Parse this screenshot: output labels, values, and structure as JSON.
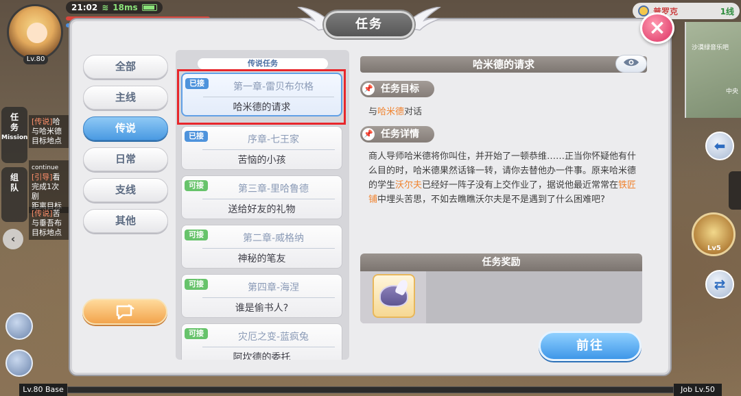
{
  "hud": {
    "time": "21:02",
    "ping": "18ms",
    "player_level": "Lv.80",
    "server_city": "普罗克",
    "server_line": "1线",
    "map_label": "沙漠绿音乐吧",
    "map_label_2": "中央",
    "mission_tab": [
      "任",
      "务",
      "Mission"
    ],
    "team_tab": [
      "组",
      "队"
    ],
    "quest_peek": [
      {
        "tag": "[传说]",
        "line1": "哈",
        "line2": "与哈米德",
        "line3": "目标地点"
      },
      {
        "tag": "[引导]",
        "line1": "看",
        "line2": "完成1次剧",
        "line3": "距离目标"
      },
      {
        "tag": "[传说]",
        "line1": "苦",
        "line2": "与垂吾布",
        "line3": "目标地点"
      }
    ],
    "continue_label": "continue",
    "skill_level": "Lv5",
    "base_level": "Lv.80 Base",
    "job_level": "Job Lv.50"
  },
  "dialog": {
    "title": "任务",
    "close_label": "×",
    "categories": [
      {
        "label": "全部",
        "active": false
      },
      {
        "label": "主线",
        "active": false
      },
      {
        "label": "传说",
        "active": true
      },
      {
        "label": "日常",
        "active": false
      },
      {
        "label": "支线",
        "active": false
      },
      {
        "label": "其他",
        "active": false
      }
    ],
    "special_button_icon": "chat-bubble-icon",
    "list_header": "传说任务",
    "quests": [
      {
        "badge": "已接",
        "badge_type": "taken",
        "chapter": "第一章-雷贝布尔格",
        "name": "哈米德的请求",
        "selected": true
      },
      {
        "badge": "已接",
        "badge_type": "taken",
        "chapter": "序章-七王家",
        "name": "苦恼的小孩",
        "selected": false
      },
      {
        "badge": "可接",
        "badge_type": "avail",
        "chapter": "第三章-里哈鲁德",
        "name": "送给好友的礼物",
        "selected": false
      },
      {
        "badge": "可接",
        "badge_type": "avail",
        "chapter": "第二章-威格纳",
        "name": "神秘的笔友",
        "selected": false
      },
      {
        "badge": "可接",
        "badge_type": "avail",
        "chapter": "第四章-海涅",
        "name": "谁是偷书人?",
        "selected": false
      },
      {
        "badge": "可接",
        "badge_type": "avail",
        "chapter": "灾厄之变-蓝疯兔",
        "name": "阿坎德的委托",
        "selected": false
      }
    ],
    "detail": {
      "title": "哈米德的请求",
      "goal_header": "任务目标",
      "goal_prefix": "与",
      "goal_highlight": "哈米德",
      "goal_suffix": "对话",
      "detail_header": "任务详情",
      "detail_part1": "商人导师哈米德将你叫住，并开始了一顿恭维……正当你怀疑他有什么目的时，哈米德果然话锋一转，请你去替他办一件事。原来哈米德的学生",
      "detail_hl1": "沃尔夫",
      "detail_part2": "已经好一阵子没有上交作业了，据说他最近常常在",
      "detail_hl2": "铁匠铺",
      "detail_part3": "中埋头苦思，不如去瞧瞧沃尔夫是不是遇到了什么困难吧?",
      "reward_header": "任务奖励",
      "reward_item_icon": "headband-icon"
    },
    "go_button": "前往"
  },
  "colors": {
    "accent_blue": "#4a9ae2",
    "highlight_orange": "#f0832f",
    "selection_red": "#e8262b",
    "badge_taken": "#4e93dc",
    "badge_available": "#67c36b"
  }
}
